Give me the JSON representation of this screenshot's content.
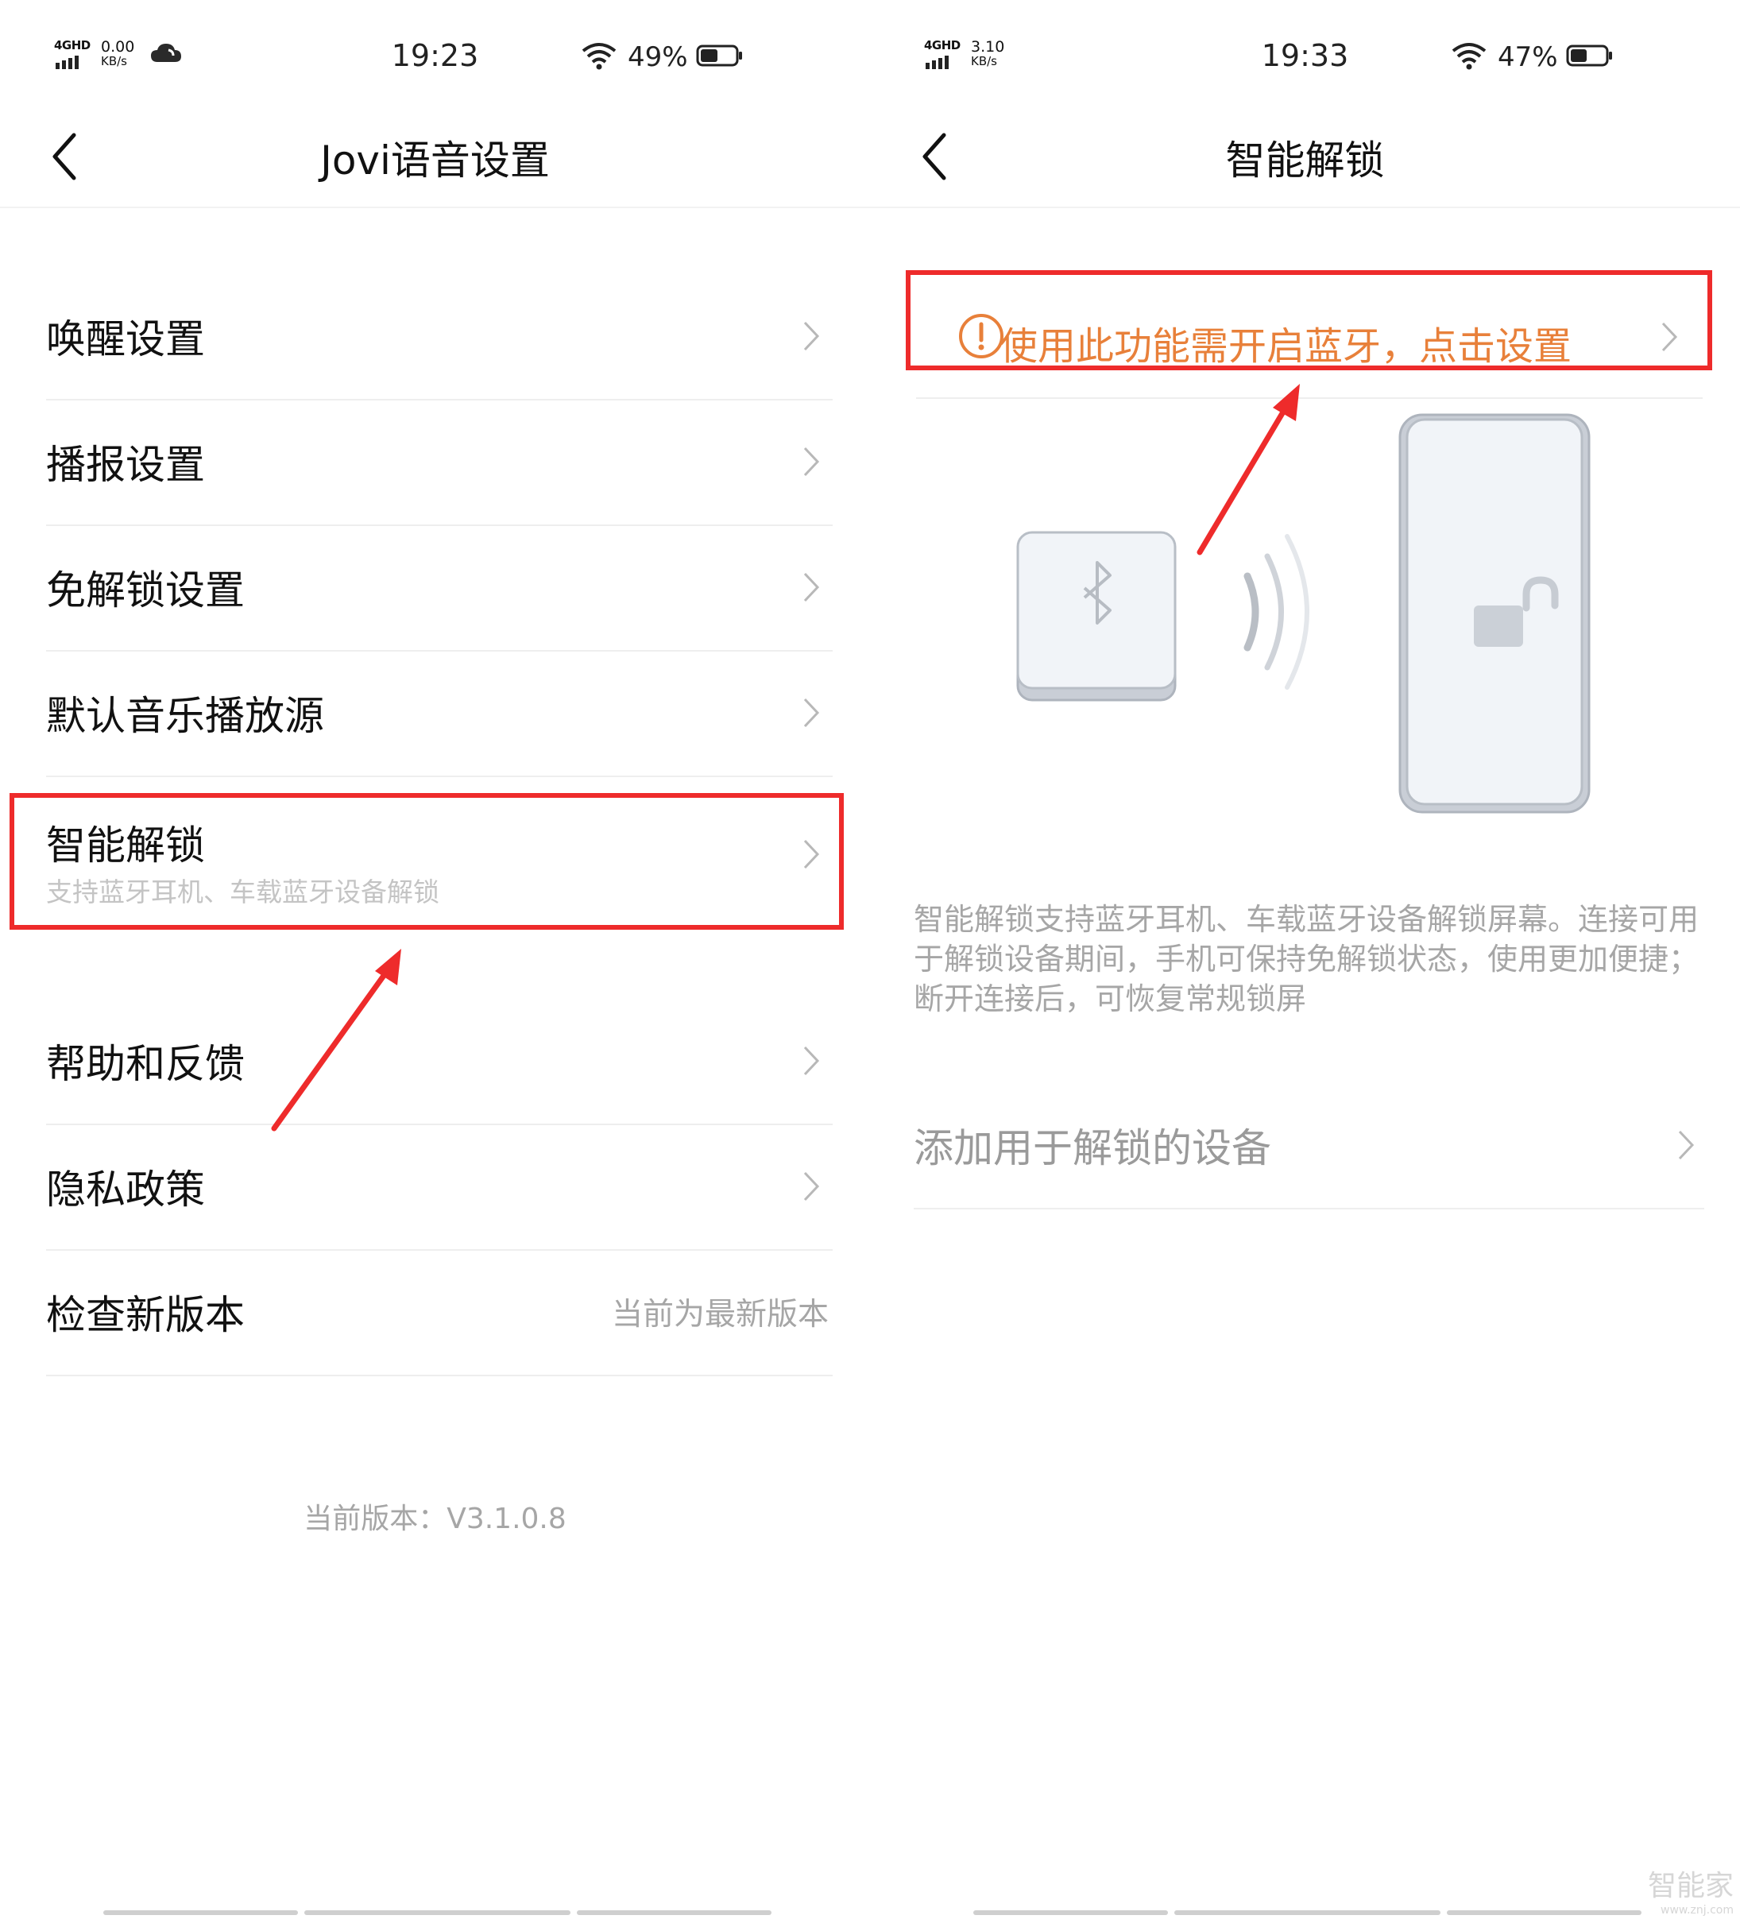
{
  "left_screen": {
    "status_bar": {
      "network": "4GHD",
      "speed_value": "0.00",
      "speed_unit": "KB/s",
      "time": "19:23",
      "battery_percent": "49%",
      "battery_level": 0.49,
      "weather_icon": "cloud-icon"
    },
    "header": {
      "title": "Jovi语音设置",
      "back_icon": "chevron-left-icon"
    },
    "menu_items": [
      {
        "label": "唤醒设置"
      },
      {
        "label": "播报设置"
      },
      {
        "label": "免解锁设置"
      },
      {
        "label": "默认音乐播放源"
      },
      {
        "label": "智能解锁",
        "subtitle": "支持蓝牙耳机、车载蓝牙设备解锁"
      },
      {
        "label": "帮助和反馈"
      },
      {
        "label": "隐私政策"
      },
      {
        "label": "检查新版本",
        "value": "当前为最新版本"
      }
    ],
    "version": "当前版本：V3.1.0.8"
  },
  "right_screen": {
    "status_bar": {
      "network": "4GHD",
      "speed_value": "3.10",
      "speed_unit": "KB/s",
      "time": "19:33",
      "battery_percent": "47%",
      "battery_level": 0.47
    },
    "header": {
      "title": "智能解锁",
      "back_icon": "chevron-left-icon"
    },
    "warning": {
      "text": "使用此功能需开启蓝牙，点击设置",
      "icon": "alert-circle-icon"
    },
    "illustration": {
      "device_icon": "bluetooth-icon",
      "phone_icon": "unlock-icon"
    },
    "description": "智能解锁支持蓝牙耳机、车载蓝牙设备解锁屏幕。连接可用于解锁设备期间，手机可保持免解锁状态，使用更加便捷；断开连接后，可恢复常规锁屏",
    "add_device": {
      "label": "添加用于解锁的设备"
    }
  },
  "watermark": {
    "brand": "智能家",
    "url": "www.znj.com"
  },
  "colors": {
    "highlight_box": "#ee2b2b",
    "warning": "#e8803a",
    "secondary_text": "#a6a6a6"
  }
}
